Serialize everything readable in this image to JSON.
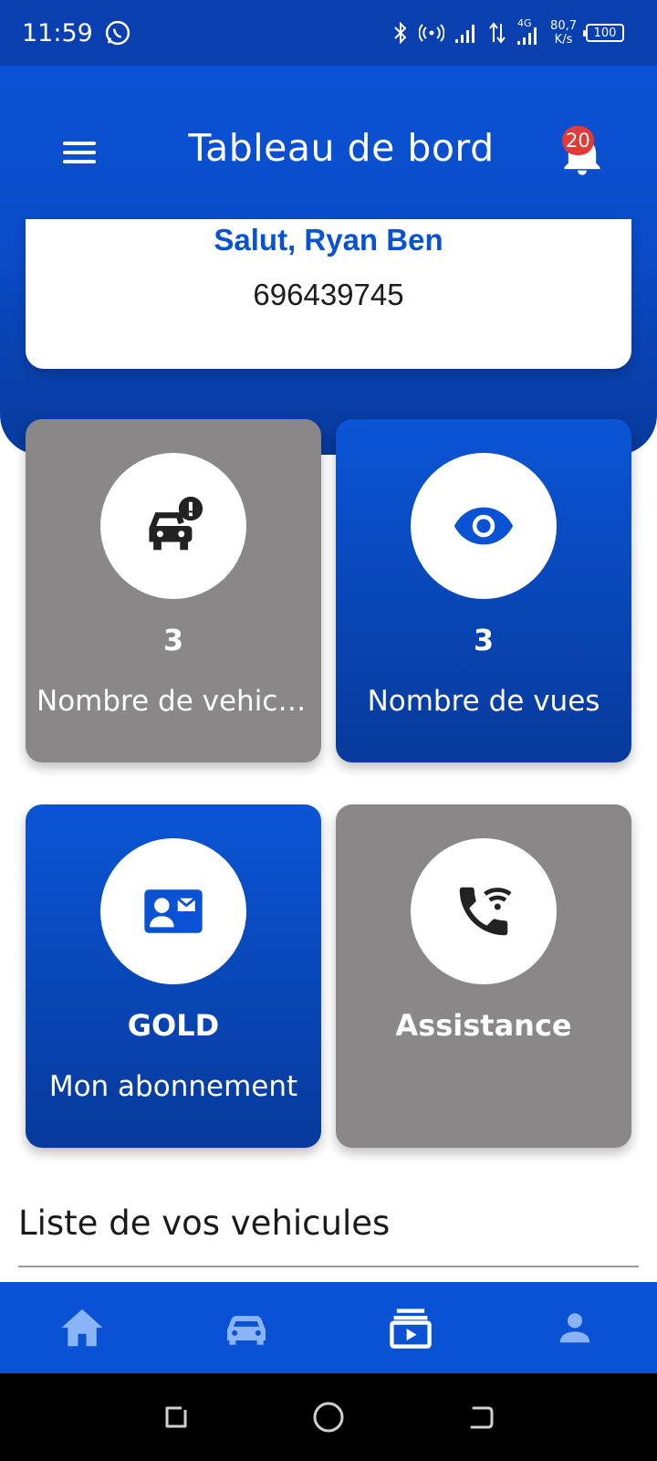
{
  "status_bar": {
    "time": "11:59",
    "network_label": "4G",
    "speed_value": "80,7",
    "speed_unit": "K/s",
    "battery": "100"
  },
  "header": {
    "title": "Tableau de bord",
    "notification_count": "20"
  },
  "greeting": {
    "name": "Salut, Ryan Ben",
    "phone": "696439745"
  },
  "tiles": [
    {
      "value": "3",
      "label": "Nombre de vehicules",
      "icon": "car-alert-icon",
      "color": "#8a8788"
    },
    {
      "value": "3",
      "label": "Nombre de vues",
      "icon": "eye-icon",
      "color": "#0a52d4"
    },
    {
      "value": "GOLD",
      "label": "Mon abonnement",
      "icon": "contact-mail-icon",
      "color": "#0a52d4"
    },
    {
      "value": "Assistance",
      "label": "",
      "icon": "phone-wifi-icon",
      "color": "#8a8788"
    }
  ],
  "section": {
    "title": "Liste de vos vehicules"
  },
  "bottom_nav": [
    {
      "icon": "home-icon"
    },
    {
      "icon": "car-icon"
    },
    {
      "icon": "subscriptions-icon"
    },
    {
      "icon": "person-icon"
    }
  ],
  "colors": {
    "primary": "#0a52d4",
    "primary_dark": "#073a9b",
    "tile_gray": "#8a8788",
    "badge": "#e53935"
  }
}
